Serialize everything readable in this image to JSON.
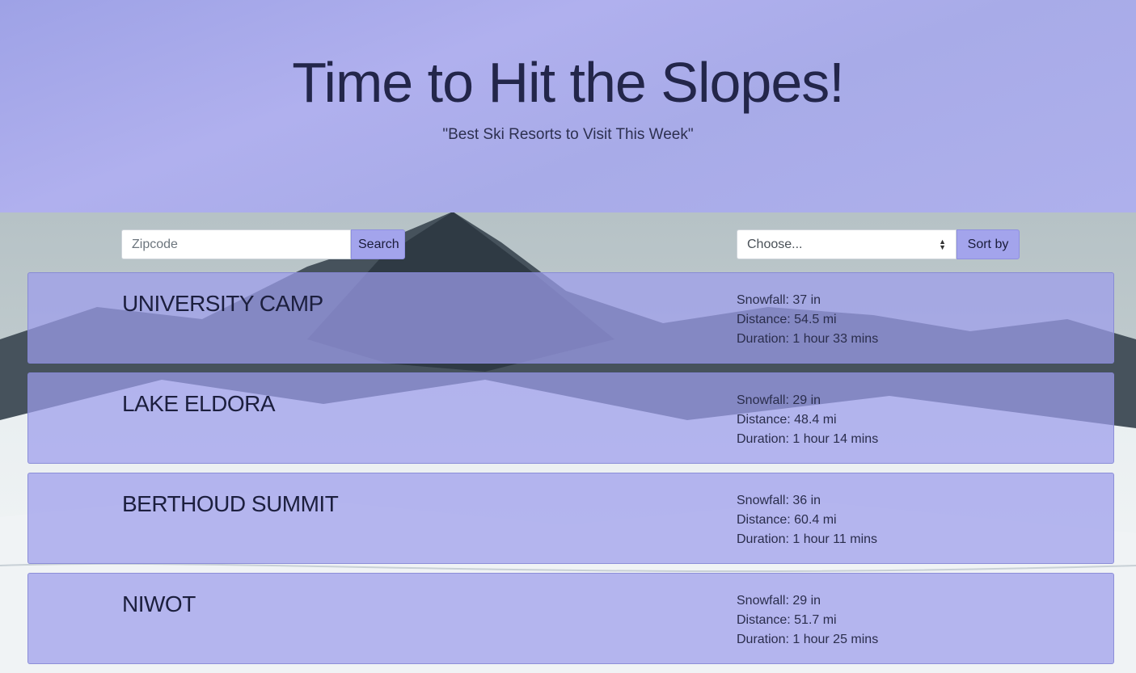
{
  "header": {
    "title": "Time to Hit the Slopes!",
    "subtitle": "\"Best Ski Resorts to Visit This Week\""
  },
  "search": {
    "placeholder": "Zipcode",
    "value": "",
    "button_label": "Search"
  },
  "sort": {
    "selected": "Choose...",
    "button_label": "Sort by"
  },
  "resorts": [
    {
      "name": "UNIVERSITY CAMP",
      "snowfall": "Snowfall: 37 in",
      "distance": "Distance: 54.5 mi",
      "duration": "Duration: 1 hour 33 mins"
    },
    {
      "name": "LAKE ELDORA",
      "snowfall": "Snowfall: 29 in",
      "distance": "Distance: 48.4 mi",
      "duration": "Duration: 1 hour 14 mins"
    },
    {
      "name": "BERTHOUD SUMMIT",
      "snowfall": "Snowfall: 36 in",
      "distance": "Distance: 60.4 mi",
      "duration": "Duration: 1 hour 11 mins"
    },
    {
      "name": "NIWOT",
      "snowfall": "Snowfall: 29 in",
      "distance": "Distance: 51.7 mi",
      "duration": "Duration: 1 hour 25 mins"
    }
  ],
  "colors": {
    "accent": "#a3a4ec",
    "card_overlay": "#9c9cec",
    "title_text": "#23264a"
  }
}
